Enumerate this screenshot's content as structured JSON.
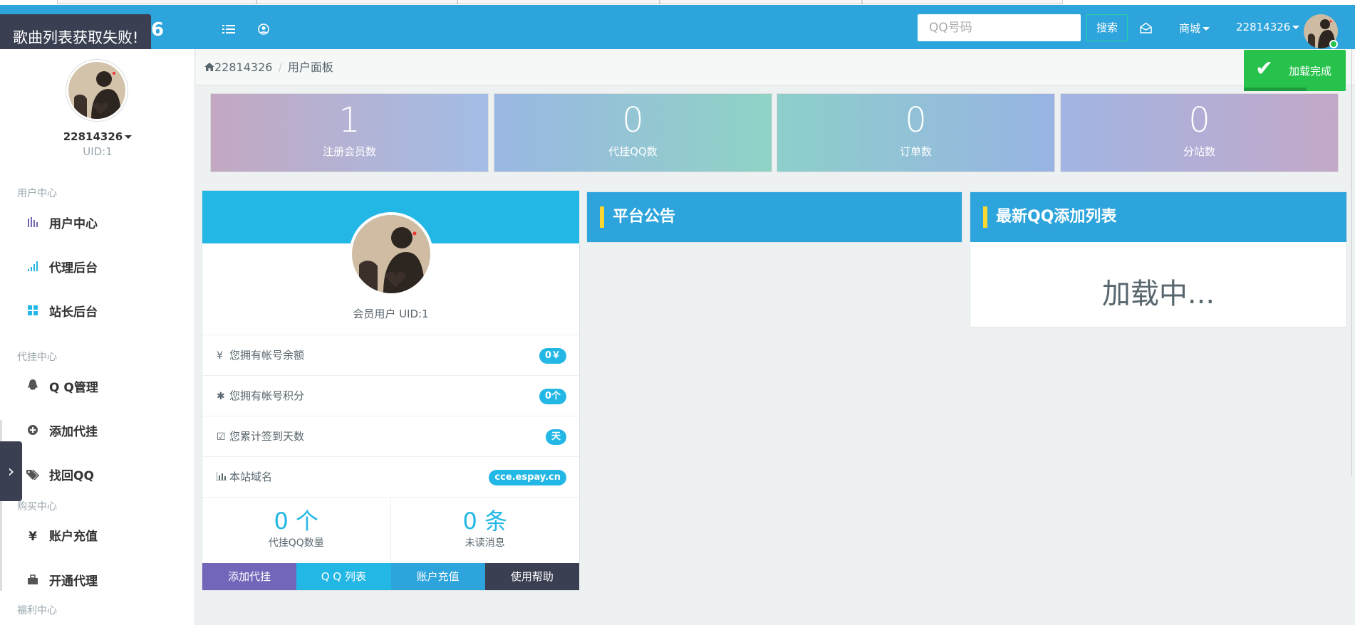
{
  "header": {
    "brand_fragment": "6",
    "search_placeholder": "QQ号码",
    "search_button": "搜索",
    "shop_label": "商城",
    "username": "22814326"
  },
  "toasts": {
    "error": "歌曲列表获取失败!",
    "success": "加载完成"
  },
  "sidebar": {
    "username": "22814326",
    "uid": "UID:1",
    "groups": [
      {
        "title": "用户中心",
        "items": [
          {
            "label": "用户中心",
            "icon": "bar-chart-icon"
          },
          {
            "label": "代理后台",
            "icon": "signal-icon"
          },
          {
            "label": "站长后台",
            "icon": "grid-icon"
          }
        ]
      },
      {
        "title": "代挂中心",
        "items": [
          {
            "label": "Q Q管理",
            "icon": "qq-penguin-icon"
          },
          {
            "label": "添加代挂",
            "icon": "plus-circle-icon"
          },
          {
            "label": "找回QQ",
            "icon": "tags-icon"
          }
        ]
      },
      {
        "title": "购买中心",
        "items": [
          {
            "label": "账户充值",
            "icon": "yen-icon"
          },
          {
            "label": "开通代理",
            "icon": "briefcase-icon"
          }
        ]
      },
      {
        "title": "福利中心",
        "items": []
      }
    ]
  },
  "breadcrumb": {
    "home": "22814326",
    "current": "用户面板"
  },
  "stats": [
    {
      "value": "1",
      "label": "注册会员数"
    },
    {
      "value": "0",
      "label": "代挂QQ数"
    },
    {
      "value": "0",
      "label": "订单数"
    },
    {
      "value": "0",
      "label": "分站数"
    }
  ],
  "profile": {
    "role": "会员用户 UID:1",
    "rows": [
      {
        "icon": "¥",
        "label": "您拥有帐号余额",
        "badge": "0￥"
      },
      {
        "icon": "✱",
        "label": "您拥有帐号积分",
        "badge": "0个"
      },
      {
        "icon": "☑",
        "label": "您累计签到天数",
        "badge": "天"
      },
      {
        "icon": "📊",
        "label": "本站域名",
        "badge": "cce.espay.cn"
      }
    ],
    "qq_count_value": "0 个",
    "qq_count_label": "代挂QQ数量",
    "unread_value": "0 条",
    "unread_label": "未读消息",
    "buttons": [
      "添加代挂",
      "Q Q 列表",
      "账户充值",
      "使用帮助"
    ]
  },
  "announcement": {
    "title": "平台公告"
  },
  "latest_qq": {
    "title": "最新QQ添加列表",
    "loading": "加载中..."
  },
  "colors": {
    "header": "#2ea4dc",
    "accent": "#23b7e5",
    "success": "#27c24c",
    "dark": "#3a3f51",
    "btn_purple": "#7266ba",
    "btn_cyan": "#23b7e5",
    "btn_blue": "#2ea4dc",
    "btn_dark": "#3a3f51"
  }
}
